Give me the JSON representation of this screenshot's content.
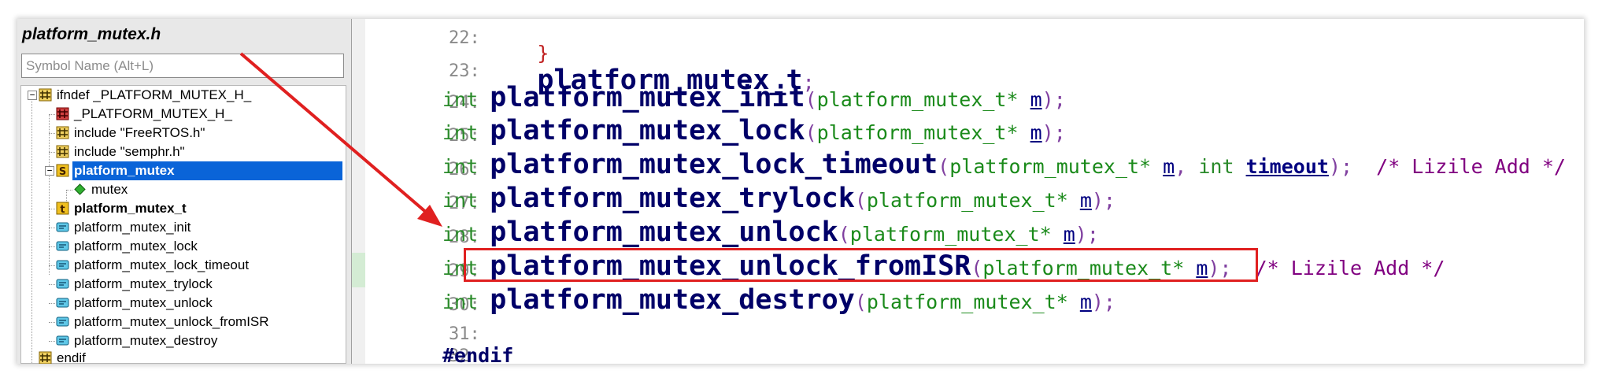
{
  "panel": {
    "title": "platform_mutex.h",
    "search_placeholder": "Symbol Name (Alt+L)",
    "tree": [
      {
        "label": "ifndef _PLATFORM_MUTEX_H_",
        "icon": "preprocessor-icon",
        "toggle": "−"
      },
      {
        "label": "_PLATFORM_MUTEX_H_",
        "icon": "define-icon"
      },
      {
        "label": "include \"FreeRTOS.h\"",
        "icon": "preprocessor-icon"
      },
      {
        "label": "include \"semphr.h\"",
        "icon": "preprocessor-icon"
      },
      {
        "label": "platform_mutex",
        "icon": "struct-icon",
        "toggle": "−",
        "selected": true
      },
      {
        "label": "mutex",
        "icon": "member-icon"
      },
      {
        "label": "platform_mutex_t",
        "icon": "typedef-icon",
        "bold": true
      },
      {
        "label": "platform_mutex_init",
        "icon": "function-icon"
      },
      {
        "label": "platform_mutex_lock",
        "icon": "function-icon"
      },
      {
        "label": "platform_mutex_lock_timeout",
        "icon": "function-icon"
      },
      {
        "label": "platform_mutex_trylock",
        "icon": "function-icon"
      },
      {
        "label": "platform_mutex_unlock",
        "icon": "function-icon"
      },
      {
        "label": "platform_mutex_unlock_fromISR",
        "icon": "function-icon"
      },
      {
        "label": "platform_mutex_destroy",
        "icon": "function-icon"
      },
      {
        "label": "endif",
        "icon": "preprocessor-icon"
      }
    ]
  },
  "code": {
    "lines": [
      {
        "num": "22:",
        "brace": "}",
        "name": "platform_mutex_t",
        "end": ";"
      },
      {
        "num": "23:"
      },
      {
        "num": "24:",
        "type": "int",
        "name": "platform_mutex_init",
        "open": "(",
        "ptype": "platform_mutex_t*",
        "param": "m",
        "close": ");"
      },
      {
        "num": "25:",
        "type": "int",
        "name": "platform_mutex_lock",
        "open": "(",
        "ptype": "platform_mutex_t*",
        "param": "m",
        "close": ");"
      },
      {
        "num": "26:",
        "type": "int",
        "name": "platform_mutex_lock_timeout",
        "open": "(",
        "ptype": "platform_mutex_t*",
        "param": "m",
        "sep": ",",
        "ptype2": "int",
        "param2": "timeout",
        "close": ");",
        "comment": "/* Lizile Add */"
      },
      {
        "num": "27:",
        "type": "int",
        "name": "platform_mutex_trylock",
        "open": "(",
        "ptype": "platform_mutex_t*",
        "param": "m",
        "close": ");"
      },
      {
        "num": "28:",
        "type": "int",
        "name": "platform_mutex_unlock",
        "open": "(",
        "ptype": "platform_mutex_t*",
        "param": "m",
        "close": ");"
      },
      {
        "num": "29:",
        "type": "int",
        "name": "platform_mutex_unlock_fromISR",
        "open": "(",
        "ptype": "platform_mutex_t*",
        "param": "m",
        "close": ");",
        "comment": "/* Lizile Add */"
      },
      {
        "num": "30:",
        "type": "int",
        "name": "platform_mutex_destroy",
        "open": "(",
        "ptype": "platform_mutex_t*",
        "param": "m",
        "close": ");"
      },
      {
        "num": "31:"
      },
      {
        "num": "32:",
        "directive": "#endif"
      }
    ]
  },
  "colors": {
    "highlight_box": "#e02020",
    "arrow": "#e02020",
    "selection": "#0a64d8",
    "function_name": "#000068",
    "keyword": "#2a8a2a",
    "comment": "#800080"
  }
}
